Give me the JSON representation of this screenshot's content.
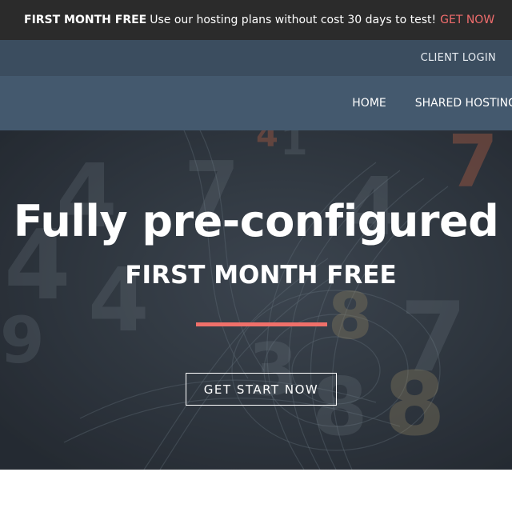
{
  "promo": {
    "strong": "FIRST MONTH FREE",
    "text": "Use our hosting plans without cost 30 days to test!",
    "link": "GET NOW"
  },
  "utility": {
    "client_login": "CLIENT LOGIN"
  },
  "nav": {
    "items": [
      "HOME",
      "SHARED HOSTING"
    ]
  },
  "hero": {
    "title": "Fully pre-configured",
    "subtitle": "FIRST MONTH FREE",
    "cta": "GET START NOW"
  },
  "colors": {
    "promo_bar": "#2b2b2b",
    "utility_bar": "#3b4d5f",
    "nav_bar": "#44596e",
    "accent": "#f0706a"
  }
}
